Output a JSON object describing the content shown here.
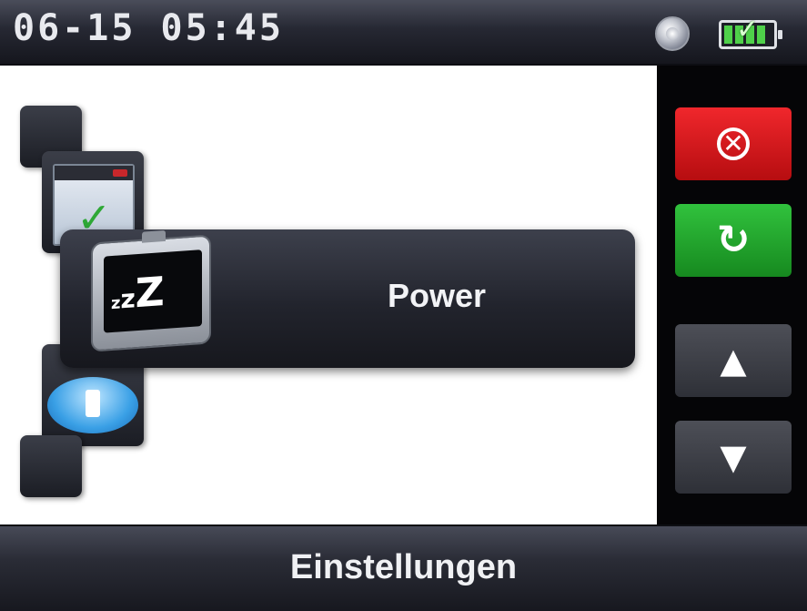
{
  "status_bar": {
    "clock": "06-15 05:45",
    "gps_icon": "gps-signal-icon",
    "battery_icon": "battery-charging-icon"
  },
  "menu": {
    "items": [
      {
        "icon": "blank-icon"
      },
      {
        "icon": "window-check-icon"
      },
      {
        "label": "Power",
        "icon": "sleep-zzz-icon",
        "selected": true
      },
      {
        "icon": "info-bubble-icon"
      },
      {
        "icon": "blank-icon"
      }
    ],
    "zzz": [
      "z",
      "z",
      "Z"
    ]
  },
  "side_buttons": {
    "cancel": {
      "icon": "cancel-icon",
      "glyph": "✕",
      "color": "#e01e24"
    },
    "refresh": {
      "icon": "refresh-icon",
      "glyph": "↻",
      "color": "#27a832"
    },
    "up": {
      "icon": "arrow-up-icon",
      "glyph": "▲"
    },
    "down": {
      "icon": "arrow-down-icon",
      "glyph": "▼"
    }
  },
  "footer": {
    "title": "Einstellungen"
  }
}
